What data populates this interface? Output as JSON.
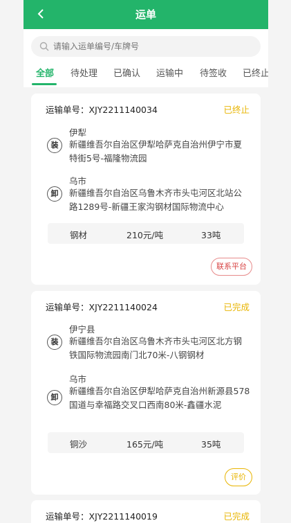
{
  "header": {
    "title": "运单"
  },
  "search": {
    "placeholder": "请输入运单编号/车牌号"
  },
  "tabs": [
    {
      "label": "全部",
      "active": true
    },
    {
      "label": "待处理"
    },
    {
      "label": "已确认"
    },
    {
      "label": "运输中"
    },
    {
      "label": "待签收"
    },
    {
      "label": "已终止"
    }
  ],
  "orders": [
    {
      "number_label": "运输单号：XJY2211140034",
      "status": "已终止",
      "load": {
        "icon": "装",
        "city": "伊犁",
        "address": "新疆维吾尔自治区伊犁哈萨克自治州伊宁市夏特街5号-福隆物流园"
      },
      "unload": {
        "icon": "卸",
        "city": "乌市",
        "address": "新疆维吾尔自治区乌鲁木齐市头屯河区北站公路1289号-新疆王家沟钢材国际物流中心"
      },
      "goods": "钢材",
      "price": "210元/吨",
      "weight": "33吨",
      "action": "联系平台"
    },
    {
      "number_label": "运输单号：XJY2211140024",
      "status": "已完成",
      "load": {
        "icon": "装",
        "city": "伊宁县",
        "address": "新疆维吾尔自治区乌鲁木齐市头屯河区北方钢铁国际物流园南门北70米-八钢钢材"
      },
      "unload": {
        "icon": "卸",
        "city": "乌市",
        "address": "新疆维吾尔自治区伊犁哈萨克自治州新源县578国道与幸福路交叉口西南80米-鑫疆水泥"
      },
      "goods": "铜沙",
      "price": "165元/吨",
      "weight": "35吨",
      "action": "评价"
    },
    {
      "number_label": "运输单号：XJY2211140019",
      "status": "已完成"
    }
  ],
  "colors": {
    "brand": "#23b46a",
    "status": "#e8b400",
    "contact": "#d84646"
  }
}
